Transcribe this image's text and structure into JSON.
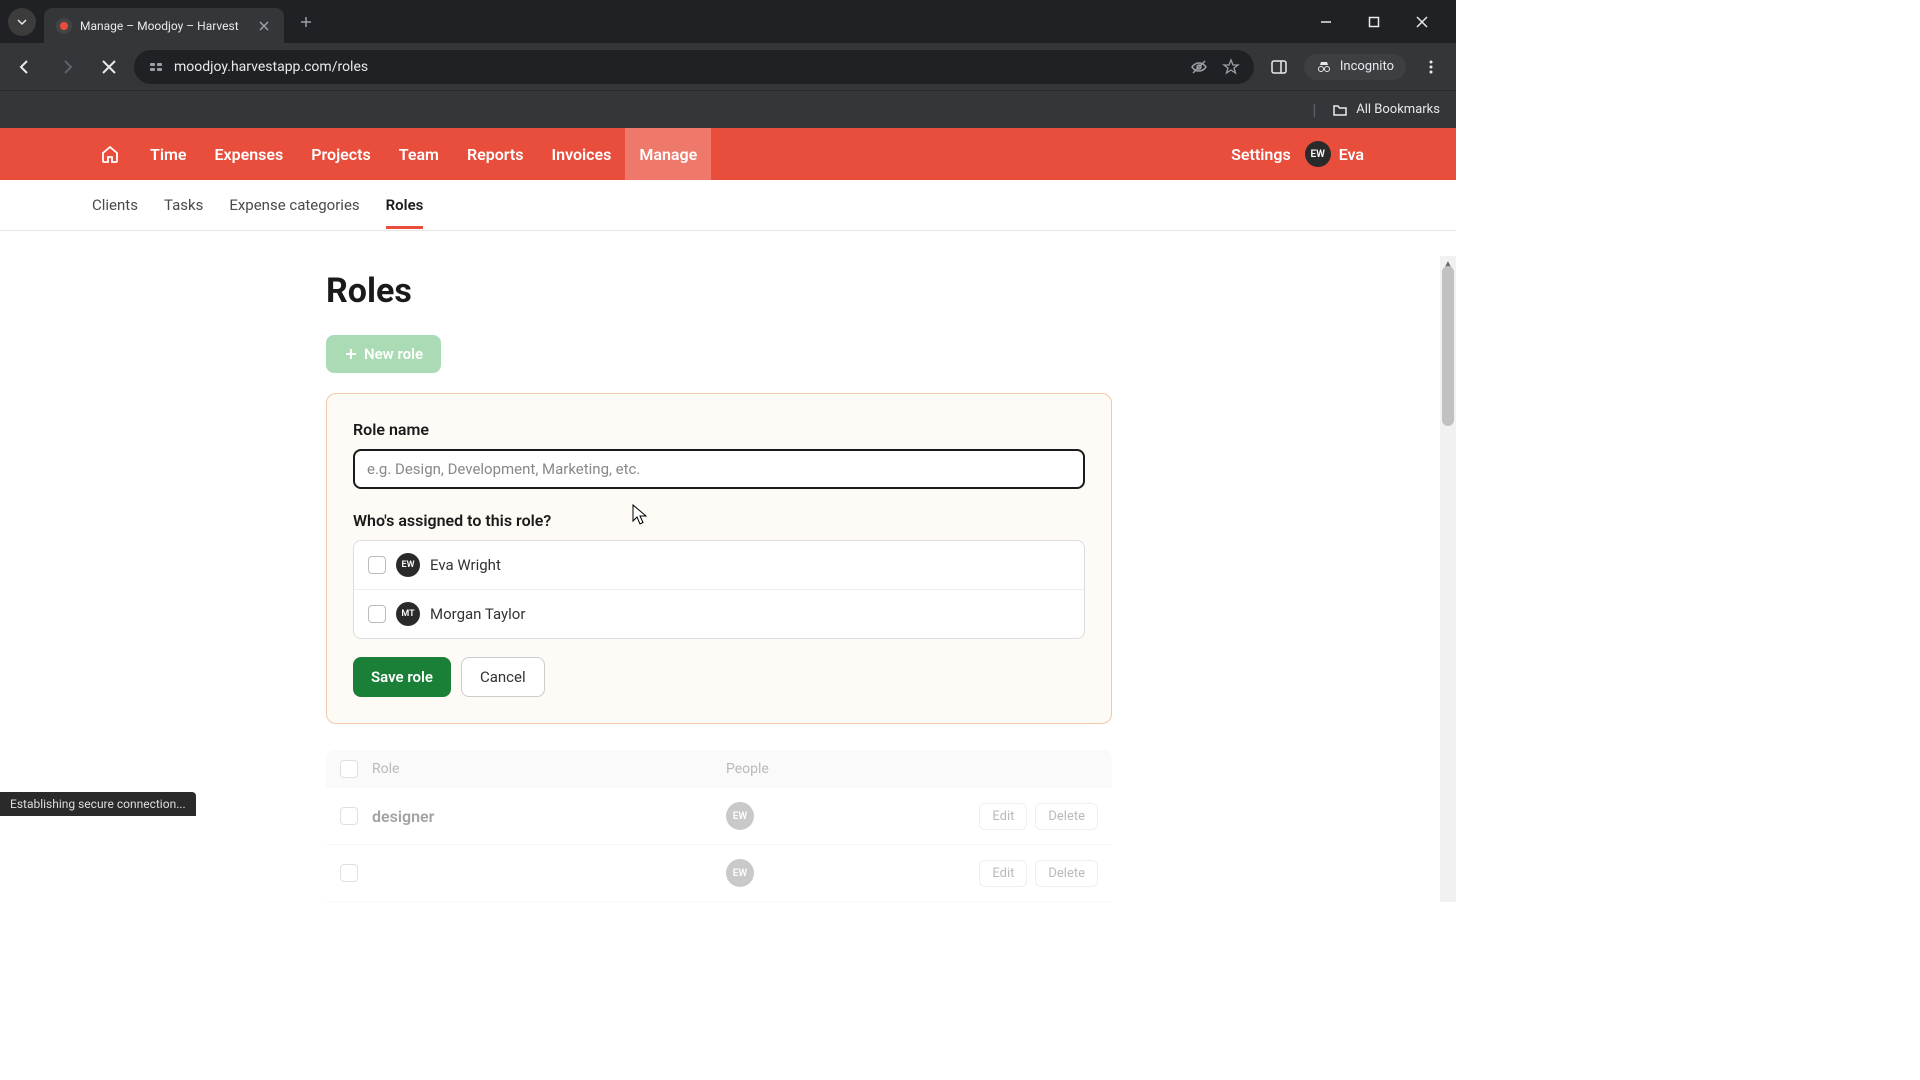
{
  "browser": {
    "tab_title": "Manage – Moodjoy – Harvest",
    "url": "moodjoy.harvestapp.com/roles",
    "incognito_label": "Incognito",
    "bookmarks_label": "All Bookmarks"
  },
  "nav": {
    "items": [
      "Time",
      "Expenses",
      "Projects",
      "Team",
      "Reports",
      "Invoices",
      "Manage"
    ],
    "active": "Manage",
    "settings_label": "Settings",
    "user_initials": "EW",
    "user_name": "Eva"
  },
  "subnav": {
    "items": [
      "Clients",
      "Tasks",
      "Expense categories",
      "Roles"
    ],
    "active": "Roles"
  },
  "page": {
    "title": "Roles",
    "new_role_label": "New role"
  },
  "form": {
    "role_name_label": "Role name",
    "role_name_placeholder": "e.g. Design, Development, Marketing, etc.",
    "assigned_label": "Who's assigned to this role?",
    "people": [
      {
        "initials": "EW",
        "name": "Eva Wright"
      },
      {
        "initials": "MT",
        "name": "Morgan Taylor"
      }
    ],
    "save_label": "Save role",
    "cancel_label": "Cancel"
  },
  "table": {
    "header_role": "Role",
    "header_people": "People",
    "edit_label": "Edit",
    "delete_label": "Delete",
    "rows": [
      {
        "role": "designer",
        "people_initials": "EW"
      },
      {
        "role": "",
        "people_initials": "EW"
      }
    ]
  },
  "status": "Establishing secure connection..."
}
